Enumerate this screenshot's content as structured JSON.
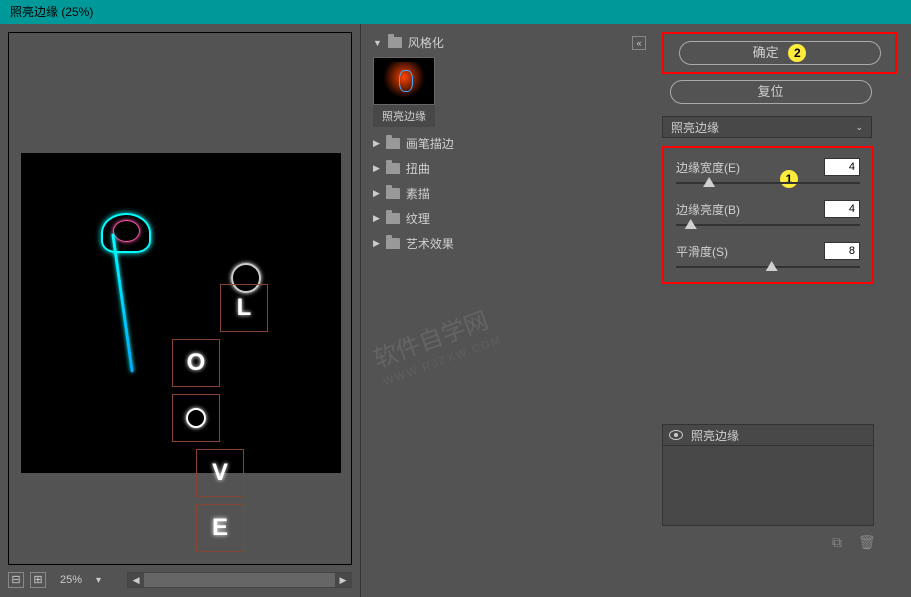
{
  "window": {
    "title": "照亮边缘 (25%)"
  },
  "preview": {
    "zoom_minus": "⊟",
    "zoom_plus": "⊞",
    "zoom_value": "25%",
    "dropdown_glyph": "▾"
  },
  "filter_tree": {
    "expanded_category": "风格化",
    "selected_thumb_label": "照亮边缘",
    "categories": [
      {
        "icon": "▶",
        "label": "画笔描边"
      },
      {
        "icon": "▶",
        "label": "扭曲"
      },
      {
        "icon": "▶",
        "label": "素描"
      },
      {
        "icon": "▶",
        "label": "纹理"
      },
      {
        "icon": "▶",
        "label": "艺术效果"
      }
    ]
  },
  "settings": {
    "ok_label": "确定",
    "reset_label": "复位",
    "filter_select_label": "照亮边缘",
    "params": {
      "edge_width": {
        "label": "边缘宽度(E)",
        "value": "4",
        "pct": 18
      },
      "edge_brightness": {
        "label": "边缘亮度(B)",
        "value": "4",
        "pct": 8
      },
      "smoothness": {
        "label": "平滑度(S)",
        "value": "8",
        "pct": 52
      }
    },
    "badge_ok": "2",
    "badge_params": "1"
  },
  "effects": {
    "item_label": "照亮边缘"
  },
  "watermark": {
    "text": "软件自学网",
    "sub": "WWW.RJZXW.COM"
  },
  "icons": {
    "collapse": "«",
    "tri_down": "▼",
    "tri_right": "▶",
    "new_layer": "⧉",
    "trash": "🗑"
  }
}
